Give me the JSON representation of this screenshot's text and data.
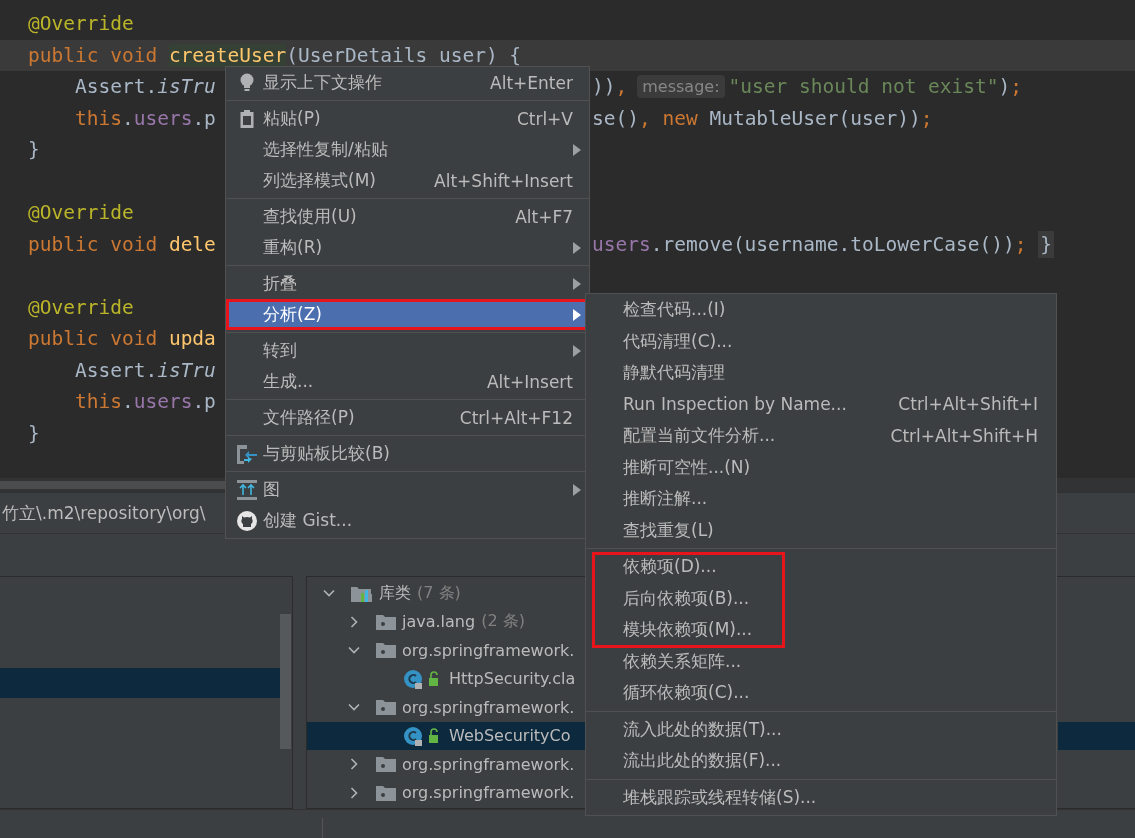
{
  "editor": {
    "lines": [
      {
        "current": false,
        "left": [
          {
            "kind": "annotation",
            "text": "@Override"
          }
        ]
      },
      {
        "current": true,
        "left": [
          {
            "kind": "keyword",
            "text": "public void "
          },
          {
            "kind": "method_match",
            "text": "createUser"
          },
          {
            "kind": "plain",
            "text": "(UserDetails user) {"
          }
        ]
      },
      {
        "current": false,
        "left": [
          {
            "kind": "plain",
            "text": "    Assert."
          },
          {
            "kind": "static_call",
            "text": "isTru"
          }
        ],
        "right": [
          {
            "kind": "code",
            "tokens": [
              {
                "kind": "plain",
                "text": "))"
              },
              {
                "kind": "punct",
                "text": ","
              }
            ]
          },
          {
            "kind": "hint",
            "text": "message:"
          },
          {
            "kind": "code",
            "tokens": [
              {
                "kind": "string",
                "text": "\"user should not exist\""
              },
              {
                "kind": "plain",
                "text": ")"
              },
              {
                "kind": "punct",
                "text": ";"
              }
            ]
          }
        ]
      },
      {
        "current": false,
        "left": [
          {
            "kind": "keyword",
            "text": "    this"
          },
          {
            "kind": "plain",
            "text": "."
          },
          {
            "kind": "field",
            "text": "users"
          },
          {
            "kind": "plain",
            "text": ".p"
          }
        ],
        "right": [
          {
            "kind": "code",
            "tokens": [
              {
                "kind": "plain",
                "text": "se()"
              },
              {
                "kind": "punct",
                "text": ", new"
              },
              {
                "kind": "plain",
                "text": " MutableUser(user))"
              },
              {
                "kind": "punct",
                "text": ";"
              }
            ]
          }
        ]
      },
      {
        "current": false,
        "left": [
          {
            "kind": "plain",
            "text": "}"
          }
        ]
      },
      {
        "current": false
      },
      {
        "current": false,
        "left": [
          {
            "kind": "annotation",
            "text": "@Override"
          }
        ]
      },
      {
        "current": false,
        "left": [
          {
            "kind": "keyword",
            "text": "public void "
          },
          {
            "kind": "method",
            "text": "dele"
          }
        ],
        "right": [
          {
            "kind": "code",
            "tokens": [
              {
                "kind": "field",
                "text": "users"
              },
              {
                "kind": "plain",
                "text": ".remove(username.toLowerCase())"
              },
              {
                "kind": "punct",
                "text": "; "
              },
              {
                "kind": "folded_brace",
                "text": "}"
              }
            ]
          }
        ]
      },
      {
        "current": false
      },
      {
        "current": false,
        "left": [
          {
            "kind": "annotation",
            "text": "@Override"
          }
        ]
      },
      {
        "current": false,
        "left": [
          {
            "kind": "keyword",
            "text": "public void "
          },
          {
            "kind": "method",
            "text": "upda"
          }
        ]
      },
      {
        "current": false,
        "left": [
          {
            "kind": "plain",
            "text": "    Assert."
          },
          {
            "kind": "static_call",
            "text": "isTru"
          }
        ]
      },
      {
        "current": false,
        "left": [
          {
            "kind": "keyword",
            "text": "    this"
          },
          {
            "kind": "plain",
            "text": "."
          },
          {
            "kind": "field",
            "text": "users"
          },
          {
            "kind": "plain",
            "text": ".p"
          }
        ]
      },
      {
        "current": false,
        "left": [
          {
            "kind": "plain",
            "text": "}"
          }
        ]
      }
    ]
  },
  "path_bar": {
    "text": "竹立\\.m2\\repository\\org\\"
  },
  "tree": [
    {
      "kind": "library",
      "label": "库类",
      "count": "(7 条)",
      "expanded": true,
      "selected": false,
      "children": [
        {
          "kind": "package",
          "label": "java.lang",
          "count": "(2 条)",
          "expanded": false,
          "selected": false
        },
        {
          "kind": "package",
          "label": "org.springframework.",
          "expanded": true,
          "selected": false,
          "children": [
            {
              "kind": "class",
              "label": "HttpSecurity.cla",
              "selected": false
            }
          ]
        },
        {
          "kind": "package",
          "label": "org.springframework.",
          "expanded": true,
          "selected": false,
          "children": [
            {
              "kind": "class",
              "label": "WebSecurityCo",
              "selected": true
            }
          ]
        },
        {
          "kind": "package",
          "label": "org.springframework.",
          "expanded": false,
          "selected": false
        },
        {
          "kind": "package",
          "label": "org.springframework.",
          "expanded": false,
          "selected": false
        }
      ]
    }
  ],
  "context_menu": {
    "items": [
      {
        "kind": "bulb_item",
        "label": "显示上下文操作",
        "shortcut": "Alt+Enter",
        "submenu": false,
        "selected": false,
        "outlined": false
      },
      {
        "kind": "separator"
      },
      {
        "kind": "clipboard_item",
        "label": "粘贴(P)",
        "shortcut": "Ctrl+V",
        "submenu": false,
        "selected": false,
        "outlined": false
      },
      {
        "kind": "item",
        "label": "选择性复制/粘贴",
        "submenu": true,
        "selected": false,
        "outlined": false
      },
      {
        "kind": "item",
        "label": "列选择模式(M)",
        "shortcut": "Alt+Shift+Insert",
        "submenu": false,
        "selected": false,
        "outlined": false
      },
      {
        "kind": "separator"
      },
      {
        "kind": "item",
        "label": "查找使用(U)",
        "shortcut": "Alt+F7",
        "submenu": false,
        "selected": false,
        "outlined": false
      },
      {
        "kind": "item",
        "label": "重构(R)",
        "submenu": true,
        "selected": false,
        "outlined": false
      },
      {
        "kind": "separator"
      },
      {
        "kind": "item",
        "label": "折叠",
        "submenu": true,
        "selected": false,
        "outlined": false
      },
      {
        "kind": "item",
        "label": "分析(Z)",
        "submenu": true,
        "selected": true,
        "outlined": true
      },
      {
        "kind": "separator"
      },
      {
        "kind": "item",
        "label": "转到",
        "submenu": true,
        "selected": false,
        "outlined": false
      },
      {
        "kind": "item",
        "label": "生成...",
        "shortcut": "Alt+Insert",
        "submenu": false,
        "selected": false,
        "outlined": false
      },
      {
        "kind": "separator"
      },
      {
        "kind": "item",
        "label": "文件路径(P)",
        "shortcut": "Ctrl+Alt+F12",
        "submenu": false,
        "selected": false,
        "outlined": false
      },
      {
        "kind": "separator"
      },
      {
        "kind": "compare_item",
        "label": "与剪贴板比较(B)",
        "submenu": false,
        "selected": false,
        "outlined": false
      },
      {
        "kind": "separator"
      },
      {
        "kind": "diagram_item",
        "label": "图",
        "submenu": true,
        "selected": false,
        "outlined": false
      },
      {
        "kind": "github_item",
        "label": "创建 Gist...",
        "submenu": false,
        "selected": false,
        "outlined": false
      }
    ]
  },
  "analyze_submenu": {
    "items": [
      {
        "kind": "item",
        "label": "检查代码...(I)"
      },
      {
        "kind": "item",
        "label": "代码清理(C)..."
      },
      {
        "kind": "item",
        "label": "静默代码清理"
      },
      {
        "kind": "item",
        "label": "Run Inspection by Name...",
        "shortcut": "Ctrl+Alt+Shift+I"
      },
      {
        "kind": "item",
        "label": "配置当前文件分析...",
        "shortcut": "Ctrl+Alt+Shift+H"
      },
      {
        "kind": "item",
        "label": "推断可空性...(N)"
      },
      {
        "kind": "item",
        "label": "推断注解..."
      },
      {
        "kind": "item",
        "label": "查找重复(L)"
      },
      {
        "kind": "separator"
      },
      {
        "kind": "group",
        "outlined": true,
        "items": [
          {
            "kind": "item",
            "label": "依赖项(D)..."
          },
          {
            "kind": "item",
            "label": "后向依赖项(B)..."
          },
          {
            "kind": "item",
            "label": "模块依赖项(M)..."
          }
        ]
      },
      {
        "kind": "item",
        "label": "依赖关系矩阵..."
      },
      {
        "kind": "item",
        "label": "循环依赖项(C)..."
      },
      {
        "kind": "separator"
      },
      {
        "kind": "item",
        "label": "流入此处的数据(T)..."
      },
      {
        "kind": "item",
        "label": "流出此处的数据(F)..."
      },
      {
        "kind": "separator"
      },
      {
        "kind": "item",
        "label": "堆栈跟踪或线程转储(S)..."
      }
    ]
  }
}
